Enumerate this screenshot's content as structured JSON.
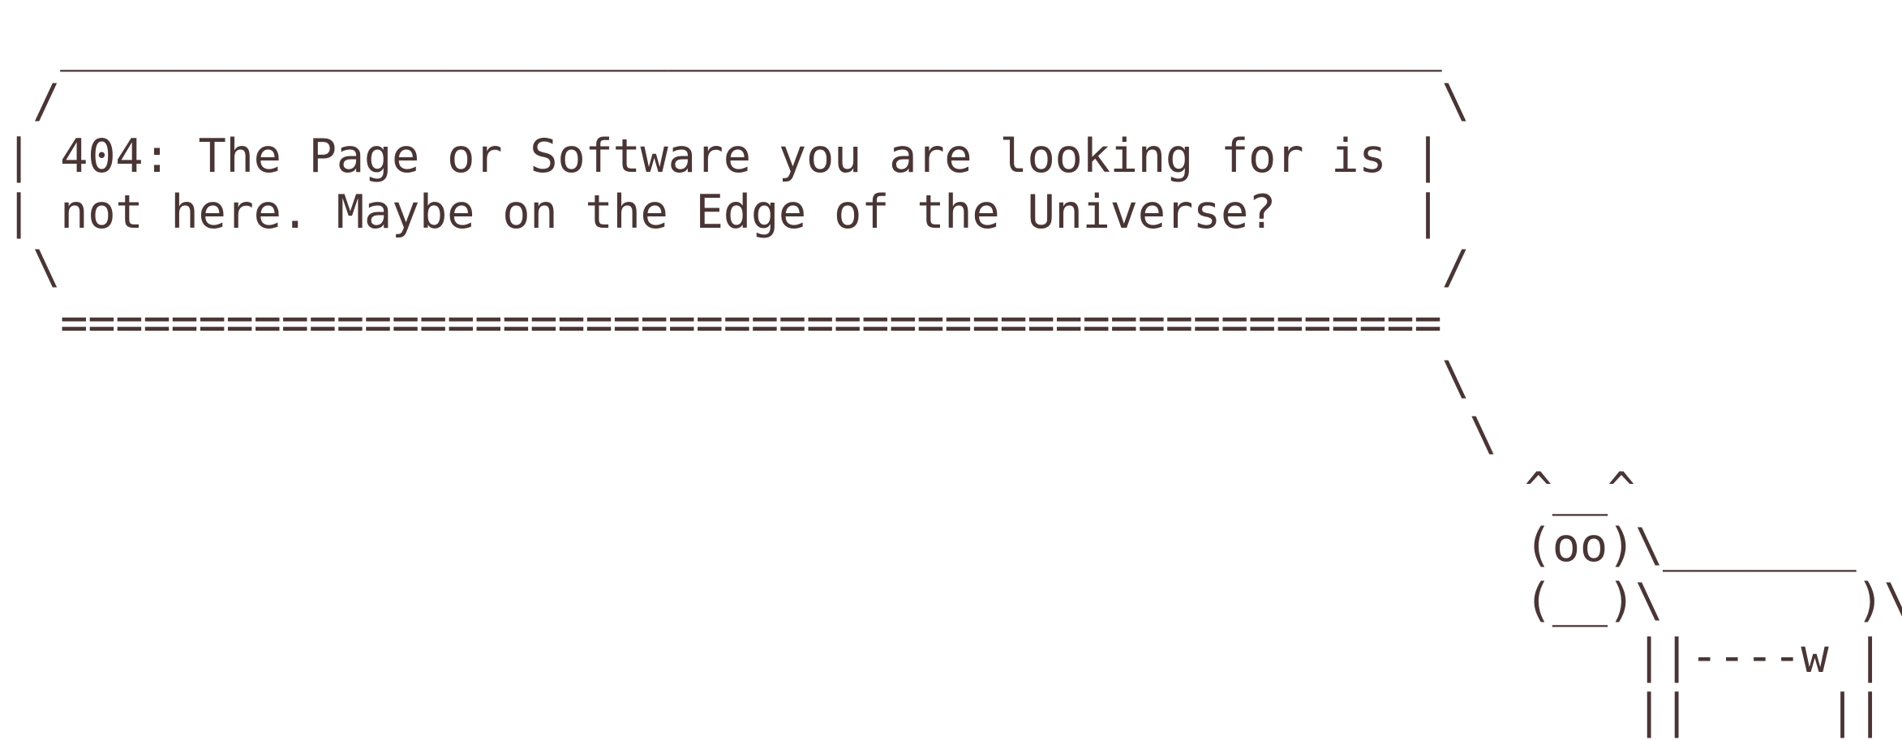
{
  "error_message": {
    "line1": "404: The Page or Software you are looking for is",
    "line2": "not here. Maybe on the Edge of the Universe?"
  },
  "ascii_art": {
    "bubble_top": "  __________________________________________________",
    "bubble_row1": " /                                                  \\",
    "bubble_text1_pre": "| ",
    "bubble_text1_post": " |",
    "bubble_text2_pre": "| ",
    "bubble_text2_post": "     |",
    "bubble_row4": " \\                                                  /",
    "bubble_bottom": "  ==================================================",
    "tail_1": "                                                    \\",
    "tail_2": "                                                     \\",
    "cow_1": "                                                       ^__^",
    "cow_2": "                                                       (oo)\\_______",
    "cow_3": "                                                       (__)\\       )\\/\\",
    "cow_4": "                                                           ||----w |",
    "cow_5": "                                                           ||     ||"
  },
  "colors": {
    "text": "#4a3535",
    "background": "#ffffff"
  }
}
